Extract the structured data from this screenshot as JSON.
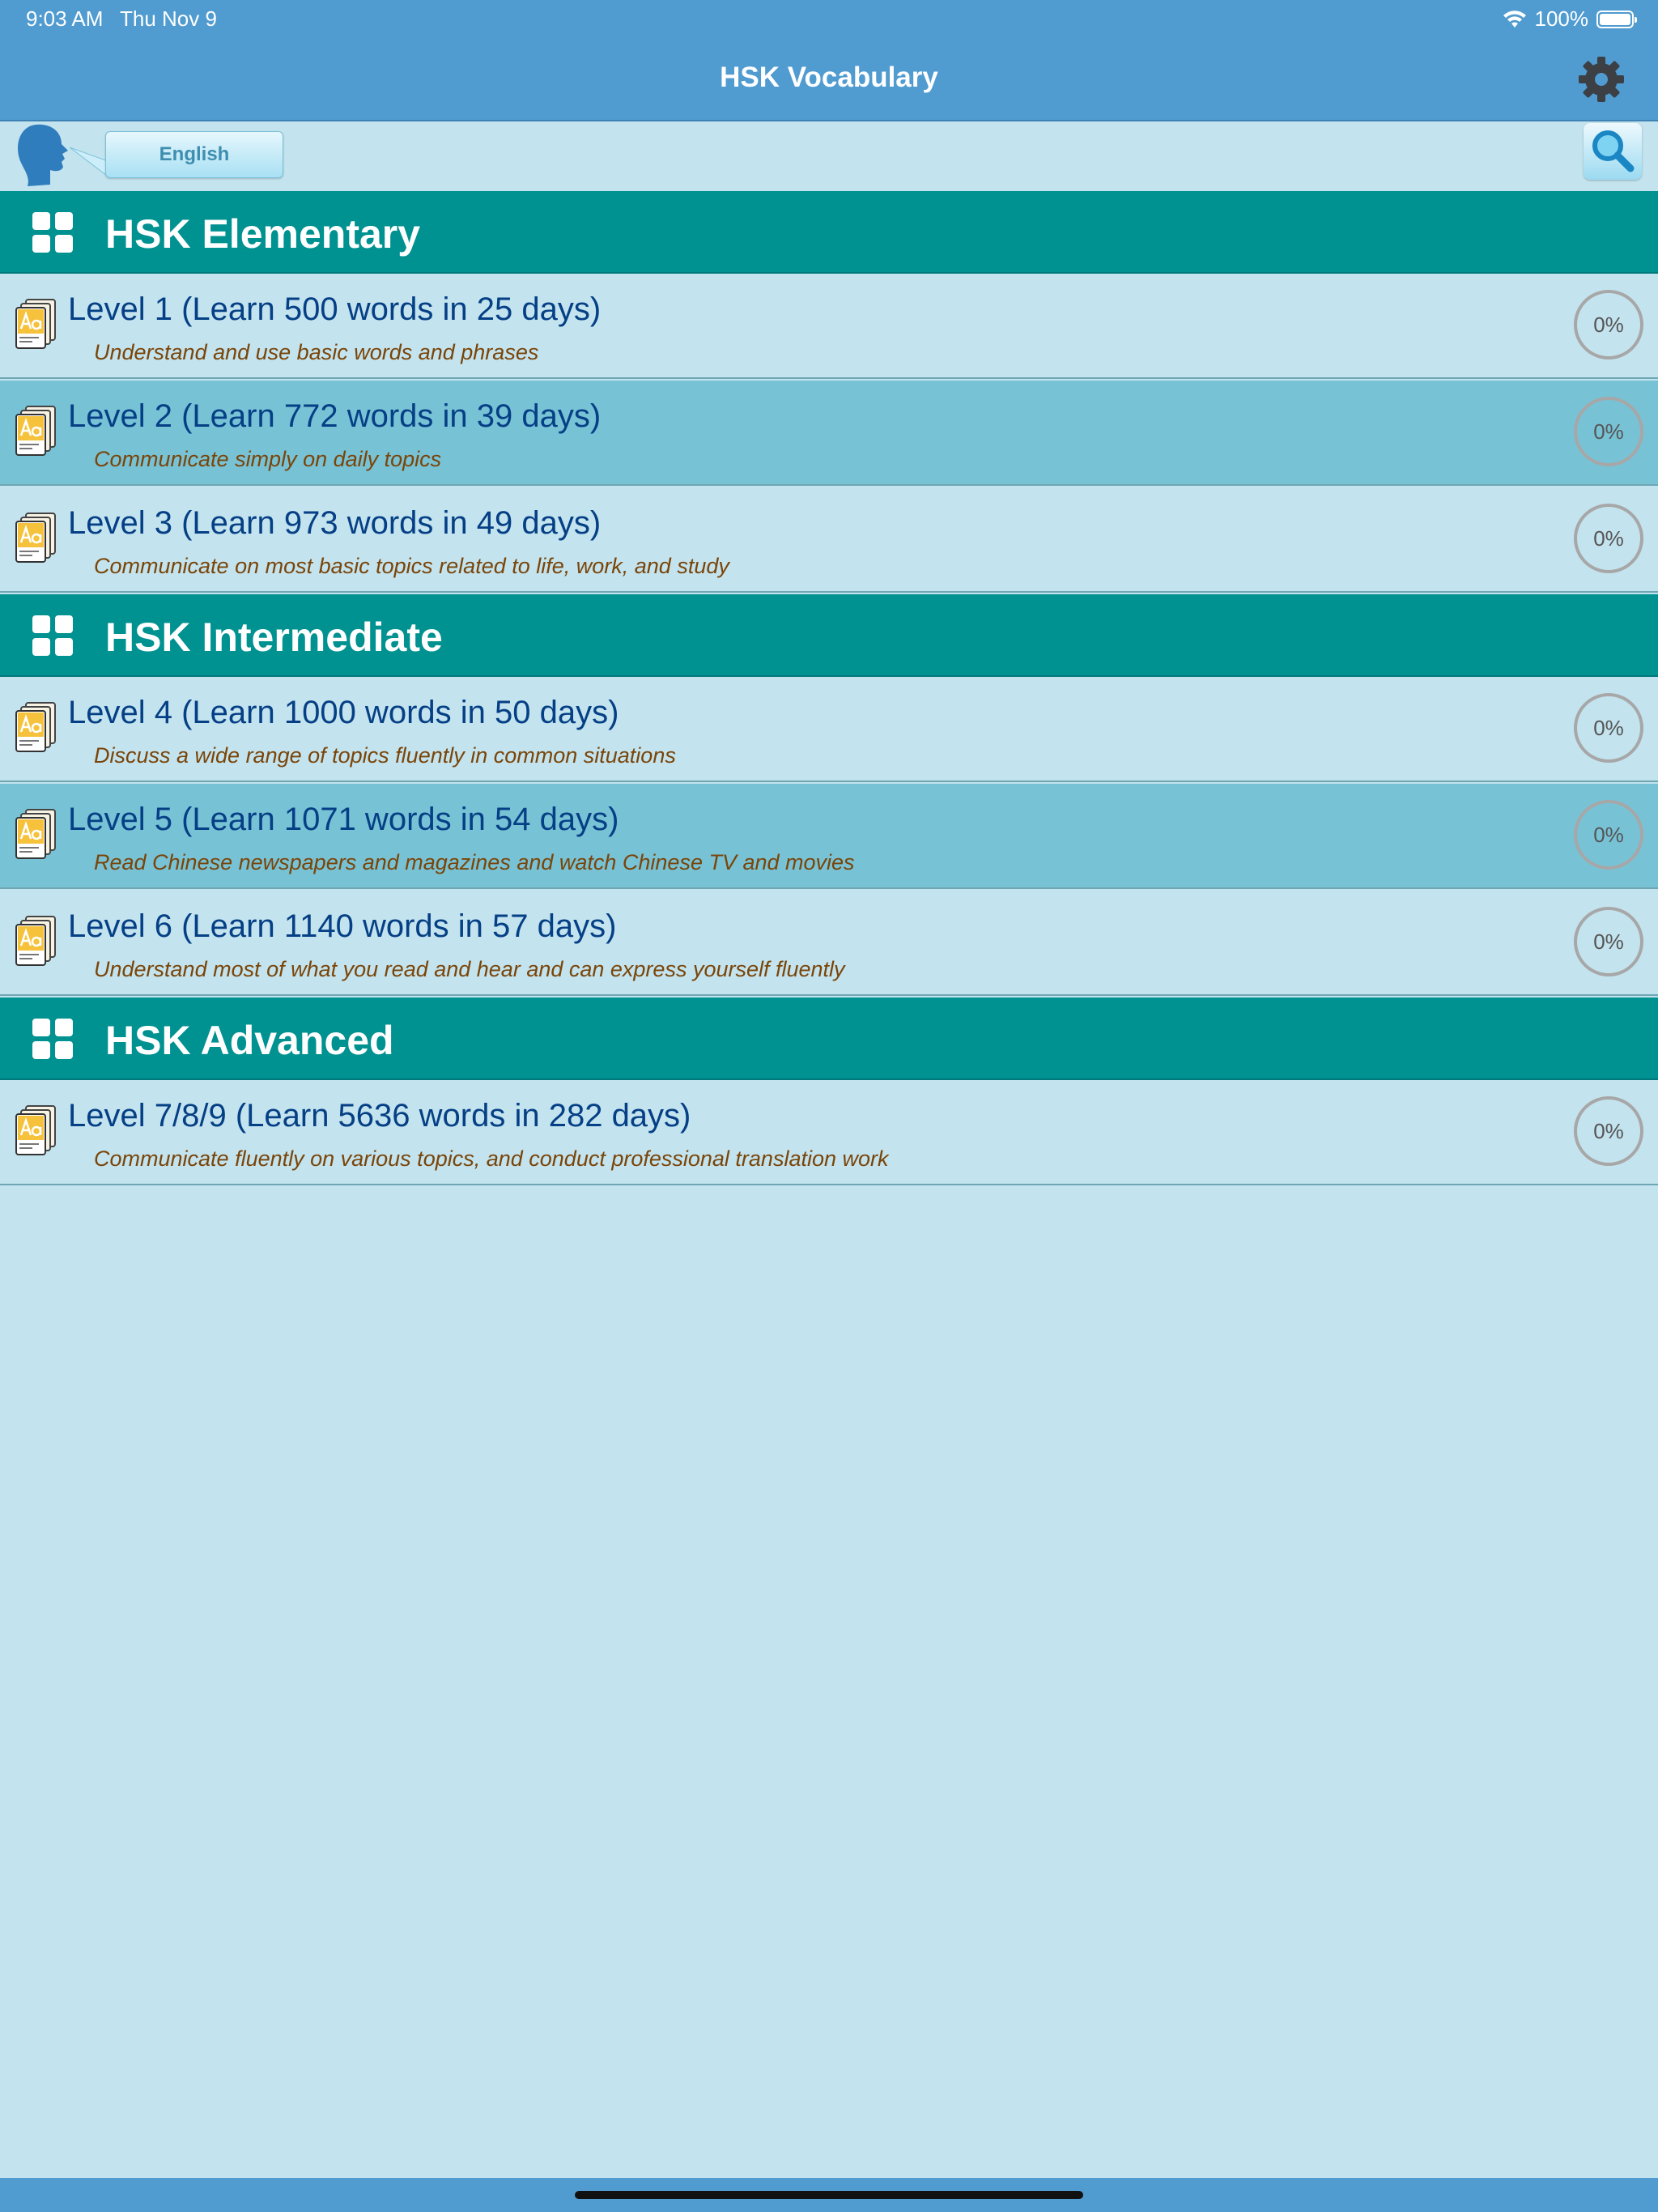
{
  "status_bar": {
    "time": "9:03 AM",
    "date": "Thu Nov 9",
    "battery": "100%"
  },
  "navbar": {
    "title": "HSK Vocabulary",
    "settings_icon": "gear-icon"
  },
  "toolbar": {
    "language_label": "English",
    "search_icon": "search-icon"
  },
  "sections": [
    {
      "title": "HSK Elementary",
      "levels": [
        {
          "title": "Level 1 (Learn 500 words in 25 days)",
          "subtitle": "Understand and use basic words and phrases",
          "progress": "0%"
        },
        {
          "title": "Level 2 (Learn 772 words in 39 days)",
          "subtitle": "Communicate simply on daily topics",
          "progress": "0%"
        },
        {
          "title": "Level 3 (Learn 973 words in 49 days)",
          "subtitle": "Communicate on most basic topics related to life, work, and study",
          "progress": "0%"
        }
      ]
    },
    {
      "title": "HSK Intermediate",
      "levels": [
        {
          "title": "Level 4 (Learn 1000 words in 50 days)",
          "subtitle": "Discuss a wide range of topics fluently in common situations",
          "progress": "0%"
        },
        {
          "title": "Level 5 (Learn 1071 words in 54 days)",
          "subtitle": "Read Chinese newspapers and magazines and watch Chinese TV and movies",
          "progress": "0%"
        },
        {
          "title": "Level 6 (Learn 1140 words in 57 days)",
          "subtitle": "Understand most of what you read and hear and can express yourself fluently",
          "progress": "0%"
        }
      ]
    },
    {
      "title": "HSK Advanced",
      "levels": [
        {
          "title": "Level 7/8/9 (Learn 5636 words in 282 days)",
          "subtitle": "Communicate fluently on various topics, and conduct professional translation work",
          "progress": "0%"
        }
      ]
    }
  ],
  "colors": {
    "bar": "#509bd0",
    "section": "#009191",
    "background": "#c3e3ee",
    "row_alt": "#78c2d6",
    "title_text": "#053f85",
    "subtitle_text": "#7a4509"
  }
}
